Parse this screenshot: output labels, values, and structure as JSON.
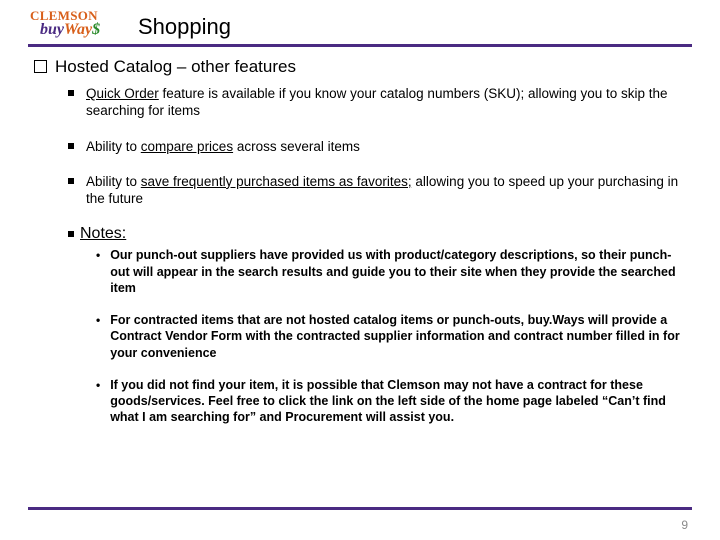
{
  "logo": {
    "clemson": "CLEMSON",
    "buy": "buy",
    "way": "Way",
    "s": "$"
  },
  "title": "Shopping",
  "section": "Hosted Catalog – other features",
  "bullets": [
    {
      "u": "Quick Order",
      "rest": " feature is available if you know your catalog numbers (SKU); allowing you to skip the searching for items"
    },
    {
      "pre": "Ability to ",
      "u": "compare prices",
      "rest": " across several items"
    },
    {
      "pre": "Ability to ",
      "u": "save frequently purchased items as favorites;",
      "rest": " allowing you to speed up your purchasing in the future"
    }
  ],
  "notes_label": "Notes:",
  "notes": [
    "Our punch-out suppliers have provided us with product/category descriptions, so their punch-out will appear in the search results and guide you to their site when they provide the searched item",
    "For contracted items that are not hosted catalog items or punch-outs, buy.Ways will provide a Contract Vendor Form with the contracted supplier information and contract number filled in for your convenience",
    "If you did not find your item, it is possible that Clemson may not have a contract for these goods/services. Feel free to click the link on the left side of the home page labeled “Can’t find what I am searching for” and Procurement will assist you."
  ],
  "page": "9"
}
